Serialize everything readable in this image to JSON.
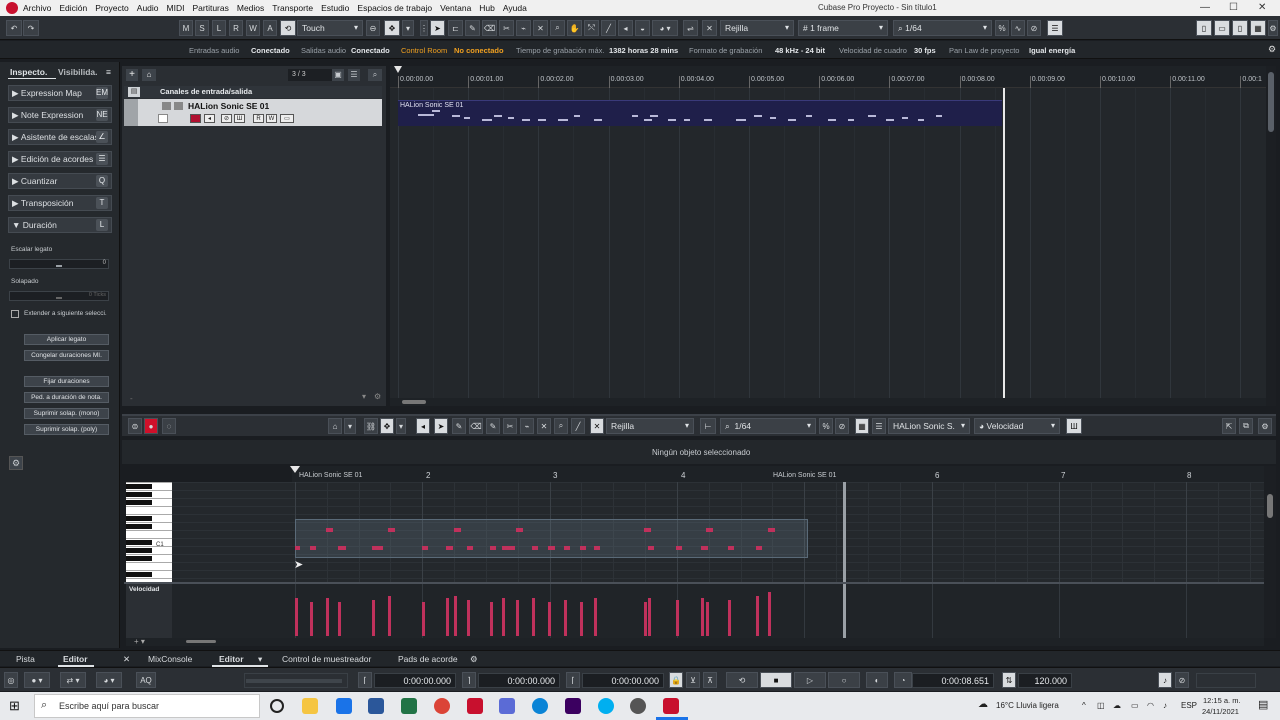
{
  "menu": {
    "items": [
      "Archivo",
      "Edición",
      "Proyecto",
      "Audio",
      "MIDI",
      "Partituras",
      "Medios",
      "Transporte",
      "Estudio",
      "Espacios de trabajo",
      "Ventana",
      "Hub",
      "Ayuda"
    ],
    "window_title": "Cubase Pro Proyecto - Sin título1",
    "min": "—",
    "max": "☐",
    "close": "✕"
  },
  "toolbar": {
    "m": "M",
    "s": "S",
    "l": "L",
    "r": "R",
    "w": "W",
    "a": "A",
    "automation_mode": "Touch",
    "snap_type": "Rejilla",
    "grid": "1 frame",
    "quantize": "1/64"
  },
  "status": {
    "inputs_label": "Entradas audio",
    "inputs_value": "Conectado",
    "outputs_label": "Salidas audio",
    "outputs_value": "Conectado",
    "control_label": "Control Room",
    "control_value": "No conectado",
    "rec_label": "Tiempo de grabación máx.",
    "rec_value": "1382 horas 28 mins",
    "format_label": "Formato de grabación",
    "format_value": "48 kHz - 24 bit",
    "frame_label": "Velocidad de cuadro",
    "frame_value": "30 fps",
    "pan_label": "Pan Law de proyecto",
    "pan_value": "Igual energía"
  },
  "inspector": {
    "tab1": "Inspecto.",
    "tab2": "Visibilida.",
    "sections": [
      {
        "label": "Expression Map",
        "icon": "EM"
      },
      {
        "label": "Note Expression",
        "icon": "NE"
      },
      {
        "label": "Asistente de escalas",
        "icon": "∠"
      },
      {
        "label": "Edición de acordes",
        "icon": "☰"
      },
      {
        "label": "Cuantizar",
        "icon": "Q"
      },
      {
        "label": "Transposición",
        "icon": "T"
      },
      {
        "label": "Duración",
        "icon": "L"
      }
    ],
    "legato_label": "Escalar legato",
    "legato_value": "0",
    "overlap_label": "Solapado",
    "overlap_value": "0 Ticks",
    "extend_label": "Extender a siguiente selecci.",
    "btn_apply": "Aplicar legato",
    "btn_freeze": "Congelar duraciones MI.",
    "btn_fix": "Fijar duraciones",
    "btn_pedal": "Ped. a duración de nota.",
    "btn_mono": "Suprimir solap. (mono)",
    "btn_poly": "Suprimir solap. (poly)"
  },
  "project": {
    "track_counter": "3 / 3",
    "folder_name": "Canales de entrada/salida",
    "track_name": "HALion Sonic SE 01",
    "part_name": "HALion Sonic SE 01",
    "ruler_labels": [
      "0.00:00.00",
      "0.00:01.00",
      "0.00:02.00",
      "0.00:03.00",
      "0.00:04.00",
      "0.00:05.00",
      "0.00:06.00",
      "0.00:07.00",
      "0.00:08.00",
      "0.00:09.00",
      "0.00:10.00",
      "0.00:11.00",
      "0.00:1"
    ]
  },
  "editor": {
    "snap_type": "Rejilla",
    "quantize": "1/64",
    "instrument": "HALion Sonic S.",
    "controller": "Velocidad",
    "info": "Ningún objeto seleccionado",
    "part_label": "HALion Sonic SE 01",
    "bar_labels": [
      "2",
      "3",
      "4",
      "6",
      "7",
      "8"
    ],
    "key_label": "C1",
    "velocity_label": "Velocidad"
  },
  "bottom_tabs": {
    "pista": "Pista",
    "editor": "Editor",
    "mixconsole": "MixConsole",
    "editor2": "Editor",
    "sampler": "Control de muestreador",
    "chords": "Pads de acorde"
  },
  "transport": {
    "left_time": "0:00:00.000",
    "right_time": "0:00:00.000",
    "punch_time": "0:00:00.000",
    "position": "0:00:08.651",
    "tempo": "120.000"
  },
  "taskbar": {
    "search_placeholder": "Escribe aquí para buscar",
    "weather": "16°C  Lluvia ligera",
    "lang": "ESP",
    "time": "12:15 a. m.",
    "date": "24/11/2021"
  },
  "colors": {
    "note": "#c0315c",
    "part_bg": "#1f1f4a",
    "accent": "#f0a020",
    "record": "#d0102a"
  }
}
